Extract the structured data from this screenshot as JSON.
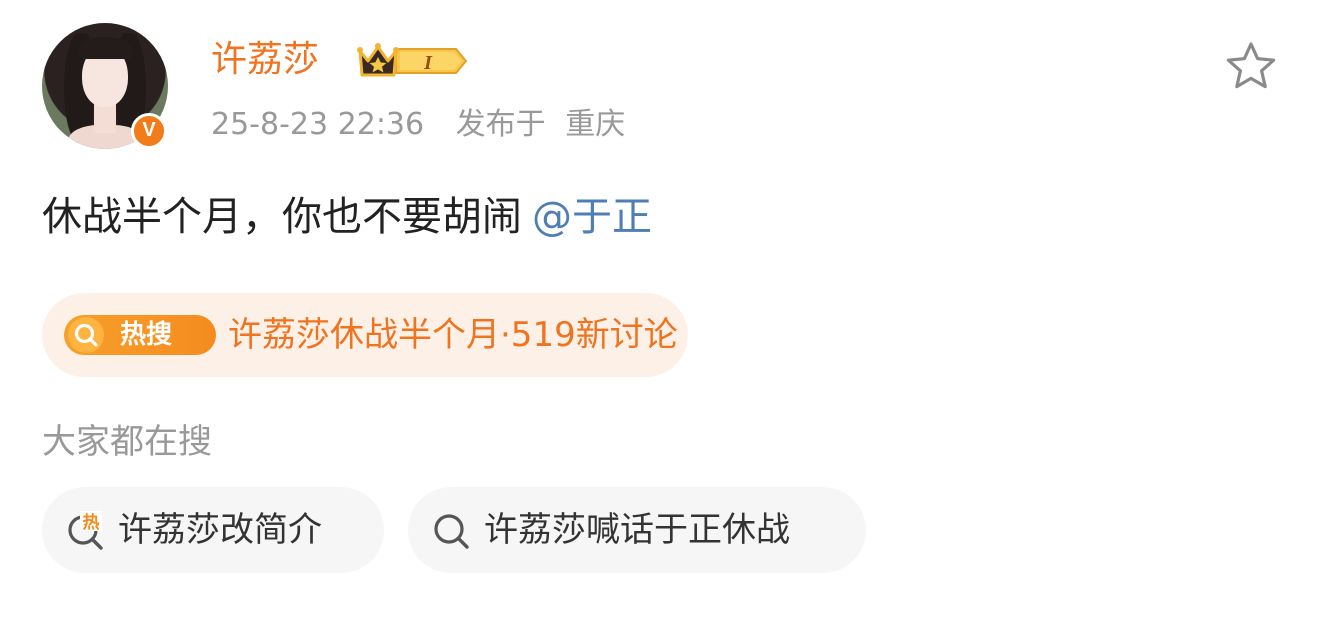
{
  "user": {
    "name": "许荔莎",
    "verified_mark": "V",
    "vip_level": "I",
    "avatar_icon": "avatar-portrait",
    "badge_icon": "crown-icon"
  },
  "post": {
    "date": "25-8-23",
    "time": "22:36",
    "location_prefix": "发布于",
    "location": "重庆",
    "text": "休战半个月，你也不要胡闹",
    "mention": "@于正"
  },
  "hot_search": {
    "tag_label": "热搜",
    "topic": "许荔莎休战半个月·519新讨论"
  },
  "everyone_searching": {
    "label": "大家都在搜",
    "items": [
      {
        "label": "许荔莎改简介",
        "icon": "hot-search-icon",
        "hot_mark": "热"
      },
      {
        "label": "许荔莎喊话于正休战",
        "icon": "search-icon"
      }
    ]
  },
  "colors": {
    "brand_orange": "#f0731f",
    "mention_blue": "#4f7eb3",
    "muted_gray": "#999999",
    "hot_pill_bg": "#fdf1e7",
    "chip_bg": "#f6f6f6"
  }
}
